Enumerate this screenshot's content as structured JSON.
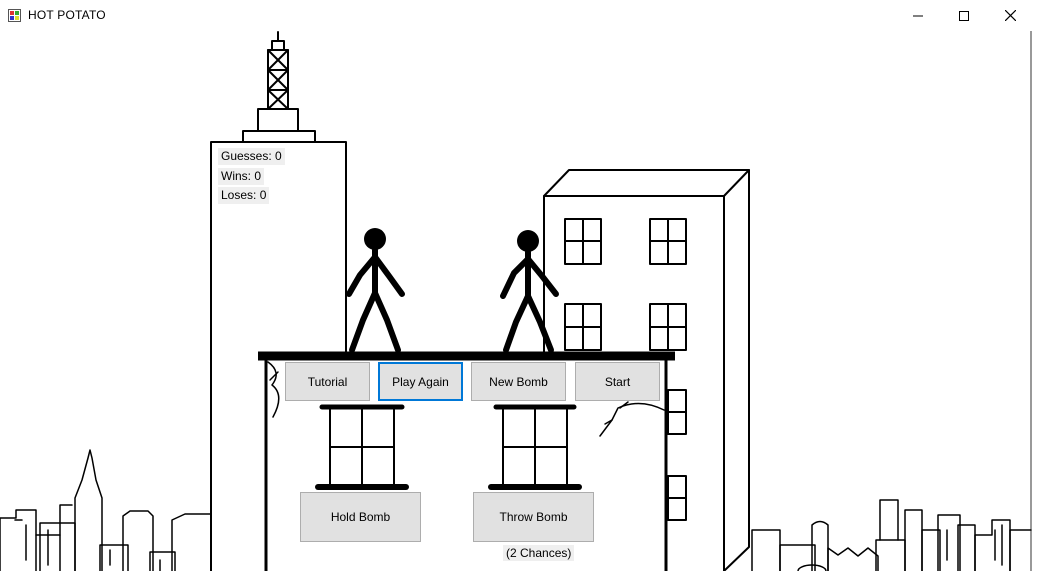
{
  "window": {
    "title": "HOT POTATO",
    "controls": [
      "minimize-icon",
      "maximize-icon",
      "close-icon"
    ]
  },
  "stats": {
    "guesses": "Guesses: 0",
    "wins": "Wins: 0",
    "loses": "Loses: 0"
  },
  "buttons": {
    "tutorial": "Tutorial",
    "play_again": "Play Again",
    "new_bomb": "New Bomb",
    "start": "Start",
    "hold_bomb": "Hold Bomb",
    "throw_bomb": "Throw Bomb"
  },
  "chances_label": "(2 Chances)",
  "colors": {
    "button_face": "#e1e1e1",
    "focus_border": "#0078d7",
    "label_background": "#efefef"
  }
}
